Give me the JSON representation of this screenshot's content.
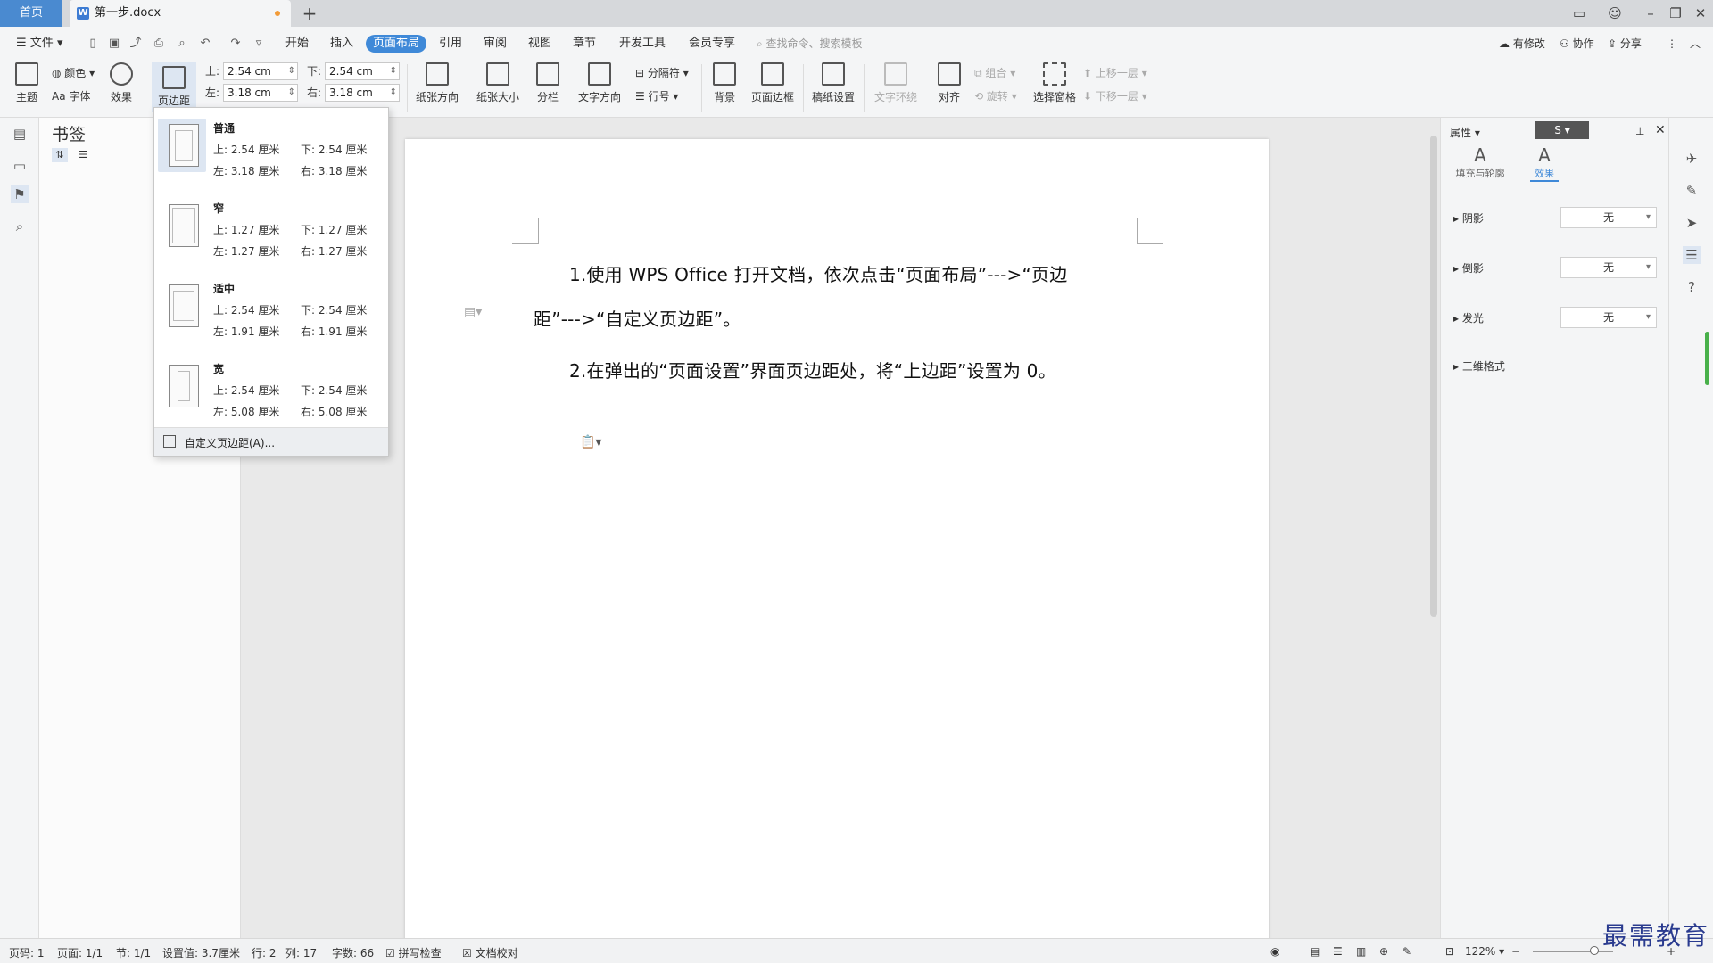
{
  "titlebar": {
    "home_tab": "首页",
    "doc_tab": "第一步.docx",
    "doc_icon": "W",
    "new_tab": "+"
  },
  "menubar": {
    "file": "文件",
    "tabs": [
      "开始",
      "插入",
      "页面布局",
      "引用",
      "审阅",
      "视图",
      "章节",
      "开发工具",
      "会员专享"
    ],
    "active_tab": "页面布局",
    "search_placeholder": "查找命令、搜索模板",
    "has_changes": "有修改",
    "collaborate": "协作",
    "share": "分享"
  },
  "ribbon": {
    "theme": "主题",
    "color": "颜色",
    "font": "Aa 字体",
    "effect": "效果",
    "margins": "页边距",
    "top_label": "上:",
    "top_value": "2.54 cm",
    "bottom_label": "下:",
    "bottom_value": "2.54 cm",
    "left_label": "左:",
    "left_value": "3.18 cm",
    "right_label": "右:",
    "right_value": "3.18 cm",
    "orientation": "纸张方向",
    "size": "纸张大小",
    "columns": "分栏",
    "text_direction": "文字方向",
    "breaks": "分隔符",
    "line_numbers": "行号",
    "background": "背景",
    "page_border": "页面边框",
    "draft_paper": "稿纸设置",
    "text_wrap": "文字环绕",
    "align": "对齐",
    "group": "组合",
    "rotate": "旋转",
    "select_pane": "选择窗格",
    "bring_forward": "上移一层",
    "send_backward": "下移一层"
  },
  "bookmark_panel": {
    "title": "书签"
  },
  "margin_dropdown": {
    "presets": [
      {
        "name": "普通",
        "top": "上: 2.54 厘米",
        "bottom": "下: 2.54 厘米",
        "left": "左: 3.18 厘米",
        "right": "右: 3.18 厘米"
      },
      {
        "name": "窄",
        "top": "上: 1.27 厘米",
        "bottom": "下: 1.27 厘米",
        "left": "左: 1.27 厘米",
        "right": "右: 1.27 厘米"
      },
      {
        "name": "适中",
        "top": "上: 2.54 厘米",
        "bottom": "下: 2.54 厘米",
        "left": "左: 1.91 厘米",
        "right": "右: 1.91 厘米"
      },
      {
        "name": "宽",
        "top": "上: 2.54 厘米",
        "bottom": "下: 2.54 厘米",
        "left": "左: 5.08 厘米",
        "right": "右: 5.08 厘米"
      }
    ],
    "custom": "自定义页边距(A)..."
  },
  "document": {
    "line1": "1.使用 WPS Office 打开文档，依次点击“页面布局”--->“页边",
    "line2": "距”--->“自定义页边距”。",
    "line3": "2.在弹出的“页面设置”界面页边距处，将“上边距”设置为 0。"
  },
  "right_pane": {
    "header": "属性",
    "tab_fill": "填充与轮廓",
    "tab_effect": "效果",
    "shadow_label": "阴影",
    "shadow_value": "无",
    "reflection_label": "倒影",
    "reflection_value": "无",
    "glow_label": "发光",
    "glow_value": "无",
    "three_d": "三维格式"
  },
  "statusbar": {
    "page_code": "页码: 1",
    "page": "页面: 1/1",
    "section": "节: 1/1",
    "setting": "设置值: 3.7厘米",
    "row": "行: 2",
    "col": "列: 17",
    "words": "字数: 66",
    "spell": "拼写检查",
    "proof": "文档校对",
    "zoom": "122%"
  },
  "watermark": "最需教育",
  "colors": {
    "accent": "#3f89d8",
    "home_tab": "#4a8ad0",
    "unsaved_dot": "#f29b38"
  }
}
